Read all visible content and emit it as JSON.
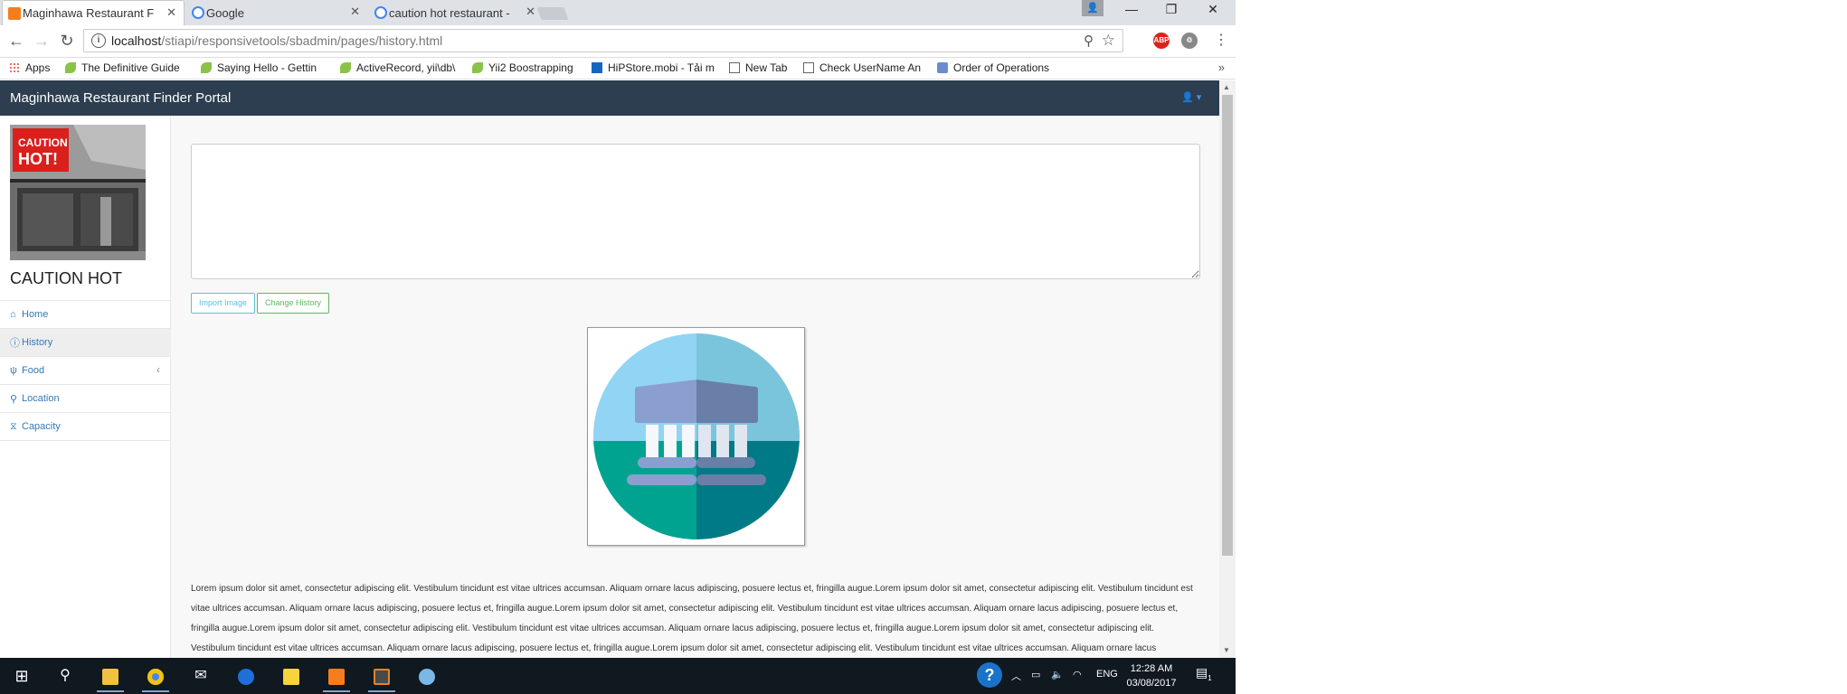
{
  "browser": {
    "tabs": [
      {
        "title": "Maginhawa Restaurant F",
        "favicon": "xampp-icon",
        "color": "#f57d1f",
        "active": true
      },
      {
        "title": "Google",
        "favicon": "google-icon",
        "color": "#4285f4",
        "active": false
      },
      {
        "title": "caution hot restaurant - ",
        "favicon": "google-icon",
        "color": "#4285f4",
        "active": false
      }
    ],
    "url_host": "localhost",
    "url_path": "/stiapi/responsivetools/sbadmin/pages/history.html",
    "window_controls": {
      "minimize": "—",
      "restore": "❐",
      "close": "✕"
    },
    "extensions": [
      {
        "label": "ABP",
        "color": "#d9241c"
      },
      {
        "label": "♲",
        "color": "#666"
      }
    ],
    "bookmarks": [
      {
        "label": "Apps",
        "icon": "apps-icon"
      },
      {
        "label": "The Definitive Guide",
        "icon": "yii-icon"
      },
      {
        "label": "Saying Hello - Gettin",
        "icon": "yii-icon"
      },
      {
        "label": "ActiveRecord, yii\\db\\",
        "icon": "yii-icon"
      },
      {
        "label": "Yii2 Boostrapping",
        "icon": "yii-icon"
      },
      {
        "label": "HiPStore.mobi - Tải m",
        "icon": "hipstore-icon"
      },
      {
        "label": "New Tab",
        "icon": "page-icon"
      },
      {
        "label": "Check UserName An",
        "icon": "page-icon"
      },
      {
        "label": "Order of Operations",
        "icon": "book-icon"
      }
    ],
    "bookmarks_more": "»"
  },
  "page": {
    "brand": "Maginhawa Restaurant Finder Portal",
    "user_menu": "👤 ▾",
    "restaurant_name": "CAUTION HOT",
    "logo_text": "CAUTION HOT!",
    "menu": [
      {
        "label": "Home",
        "icon": "home-icon",
        "glyph": "⌂",
        "active": false
      },
      {
        "label": "History",
        "icon": "info-icon",
        "glyph": "ⓘ",
        "active": true
      },
      {
        "label": "Food",
        "icon": "cutlery-icon",
        "glyph": "🍴",
        "active": false,
        "arrow": "‹"
      },
      {
        "label": "Location",
        "icon": "map-marker-icon",
        "glyph": "⚲",
        "active": false
      },
      {
        "label": "Capacity",
        "icon": "filter-icon",
        "glyph": "⧗",
        "active": false
      }
    ],
    "editor_value": "",
    "buttons": {
      "import": "Import Image",
      "change": "Change History"
    },
    "history_image": "museum-building-icon",
    "lorem": "Lorem ipsum dolor sit amet, consectetur adipiscing elit. Vestibulum tincidunt est vitae ultrices accumsan. Aliquam ornare lacus adipiscing, posuere lectus et, fringilla augue.Lorem ipsum dolor sit amet, consectetur adipiscing elit. Vestibulum tincidunt est vitae ultrices accumsan. Aliquam ornare lacus adipiscing, posuere lectus et, fringilla augue.Lorem ipsum dolor sit amet, consectetur adipiscing elit. Vestibulum tincidunt est vitae ultrices accumsan. Aliquam ornare lacus adipiscing, posuere lectus et, fringilla augue.Lorem ipsum dolor sit amet, consectetur adipiscing elit. Vestibulum tincidunt est vitae ultrices accumsan. Aliquam ornare lacus adipiscing, posuere lectus et, fringilla augue.Lorem ipsum dolor sit amet, consectetur adipiscing elit. Vestibulum tincidunt est vitae ultrices accumsan. Aliquam ornare lacus adipiscing, posuere lectus et, fringilla augue.Lorem ipsum dolor sit amet, consectetur adipiscing elit. Vestibulum tincidunt est vitae ultrices accumsan. Aliquam ornare lacus adipiscing, posuere lectus et, fringilla augue.Lorem ipsum dolor sit amet, consectetur adipiscing elit. Vestibulum tincidunt est vitae"
  },
  "taskbar": {
    "apps": [
      {
        "name": "start-icon",
        "glyph": "⊞",
        "running": false
      },
      {
        "name": "search-icon",
        "glyph": "⚲",
        "running": false
      },
      {
        "name": "file-explorer-icon",
        "color": "#f0c040",
        "running": true
      },
      {
        "name": "chrome-icon",
        "color": "#db4437",
        "running": true
      },
      {
        "name": "mail-icon",
        "glyph": "✉",
        "running": false
      },
      {
        "name": "messenger-icon",
        "color": "#1e6fd9",
        "running": false
      },
      {
        "name": "sticky-notes-icon",
        "color": "#f7d33c",
        "running": false
      },
      {
        "name": "xampp-icon",
        "color": "#f57d1f",
        "running": true
      },
      {
        "name": "sublime-icon",
        "color": "#e0842b",
        "running": true
      },
      {
        "name": "paint-icon",
        "color": "#7ab8e8",
        "running": false
      }
    ],
    "tray": {
      "help": "?",
      "lang": "ENG",
      "time": "12:28 AM",
      "date": "03/08/2017",
      "notif_count": "1"
    }
  }
}
